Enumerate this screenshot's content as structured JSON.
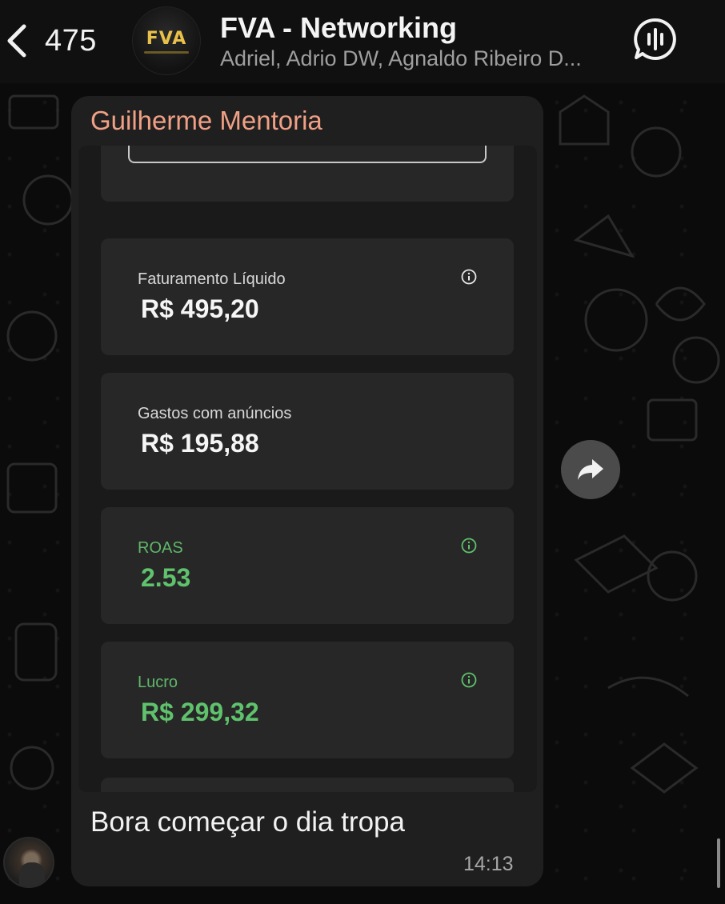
{
  "header": {
    "back_count": "475",
    "group_avatar_text": "FVA",
    "title": "FVA - Networking",
    "subtitle": "Adriel, Adrio DW, Agnaldo Ribeiro D..."
  },
  "message": {
    "sender": "Guilherme Mentoria",
    "caption": "Bora começar o dia tropa",
    "time": "14:13",
    "cards": [
      {
        "label": "Faturamento Líquido",
        "value": "R$ 495,20",
        "info": true,
        "color": "#f6f6f6"
      },
      {
        "label": "Gastos com anúncios",
        "value": "R$ 195,88",
        "info": false,
        "color": "#f6f6f6"
      },
      {
        "label": "ROAS",
        "value": "2.53",
        "info": true,
        "color": "#5fc26c"
      },
      {
        "label": "Lucro",
        "value": "R$ 299,32",
        "info": true,
        "color": "#5fc26c"
      }
    ]
  },
  "icons": {
    "back": "chevron-left-icon",
    "call": "voice-chat-icon",
    "forward": "forward-arrow-icon",
    "info": "info-icon"
  },
  "colors": {
    "sender_name": "#f0a085",
    "positive_value": "#5fc26c",
    "bubble_bg": "#1f1f1f",
    "card_bg": "#272727"
  }
}
